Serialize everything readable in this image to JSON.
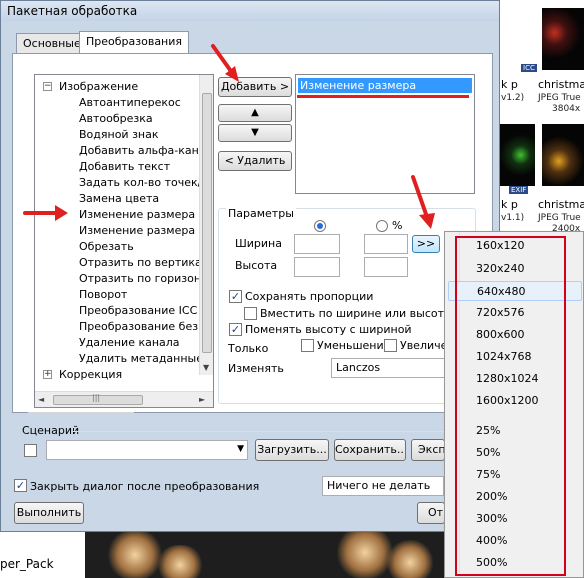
{
  "window": {
    "title": "Пакетная обработка"
  },
  "tabs": [
    {
      "label": "Основные"
    },
    {
      "label": "Преобразования"
    }
  ],
  "tree": {
    "items": [
      {
        "label": "Изображение",
        "expander": "−"
      },
      {
        "label": "Автоантиперекос"
      },
      {
        "label": "Автообрезка"
      },
      {
        "label": "Водяной знак"
      },
      {
        "label": "Добавить альфа-канал"
      },
      {
        "label": "Добавить текст"
      },
      {
        "label": "Задать кол-во точек/д"
      },
      {
        "label": "Замена цвета"
      },
      {
        "label": "Изменение размера"
      },
      {
        "label": "Изменение размера хо"
      },
      {
        "label": "Обрезать"
      },
      {
        "label": "Отразить по вертикали"
      },
      {
        "label": "Отразить по горизонта"
      },
      {
        "label": "Поворот"
      },
      {
        "label": "Преобразование ICC"
      },
      {
        "label": "Преобразование без п"
      },
      {
        "label": "Удаление канала"
      },
      {
        "label": "Удалить метаданные"
      },
      {
        "label": "Коррекция",
        "expander": "+"
      }
    ],
    "scroll_down_glyph": "▼",
    "scroll_left_glyph": "◄",
    "scroll_right_glyph": "►",
    "hthumb_grip": "|||"
  },
  "buttons": {
    "add": "Добавить >",
    "up": "▲",
    "down": "▼",
    "remove": "< Удалить",
    "presets": ">>",
    "load": "Загрузить...",
    "save": "Сохранить...",
    "export": "Экспорт",
    "run": "Выполнить",
    "close": "Отмена"
  },
  "chain": {
    "items": [
      "Изменение размера"
    ]
  },
  "params": {
    "group_label": "Параметры",
    "unit_percent": "%",
    "width_label": "Ширина",
    "height_label": "Высота",
    "keep_proportions": "Сохранять пропорции",
    "fit": "Вместить по ширине или высоте",
    "swap": "Поменять высоту с шириной",
    "only_label": "Только",
    "reduce": "Уменьшение",
    "enlarge": "Увеличение",
    "resample_label": "Изменять",
    "resample_value": "Lanczos"
  },
  "scenario": {
    "label": "Сценарий"
  },
  "close_after": "Закрыть диалог после преобразования",
  "after_action": "Ничего не делать",
  "menu": {
    "items": [
      "160x120",
      "320x240",
      "640x480",
      "720x576",
      "800x600",
      "1024x768",
      "1280x1024",
      "1600x1200",
      "25%",
      "50%",
      "75%",
      "200%",
      "300%",
      "400%",
      "500%"
    ],
    "highlighted": "640x480"
  },
  "background": {
    "thumb1_title": "christma",
    "thumb1_sub": "JPEG True",
    "thumb1_size": "3804x",
    "thumb1_badge": "v1.2)",
    "thumb2_title": "christma",
    "thumb2_sub": "JPEG True",
    "thumb2_size": "2400x",
    "thumb2_badge": "v1.1)",
    "badge_icc": "ICC",
    "badge_exif": "EXIF",
    "partial_k1": "k p",
    "partial_k2": "k p",
    "bottom_label": "per_Pack"
  },
  "colors": {
    "annotation_red": "#e02020",
    "selection_blue": "#3399ff",
    "frame_red": "#d3001b"
  }
}
